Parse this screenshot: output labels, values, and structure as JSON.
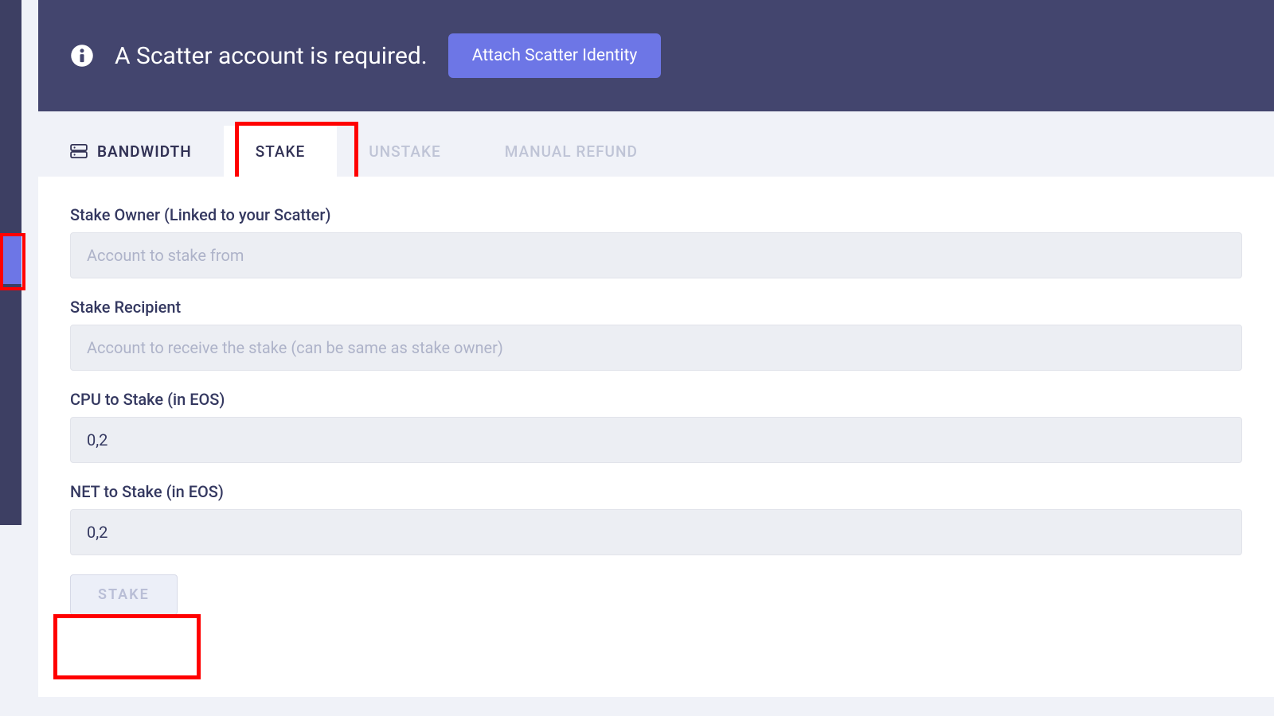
{
  "banner": {
    "message": "A Scatter account is required.",
    "attach_label": "Attach Scatter Identity"
  },
  "tabs": {
    "bandwidth": "BANDWIDTH",
    "stake": "STAKE",
    "unstake": "UNSTAKE",
    "manual_refund": "MANUAL REFUND"
  },
  "form": {
    "stake_owner": {
      "label": "Stake Owner (Linked to your Scatter)",
      "placeholder": "Account to stake from",
      "value": ""
    },
    "stake_recipient": {
      "label": "Stake Recipient",
      "placeholder": "Account to receive the stake (can be same as stake owner)",
      "value": ""
    },
    "cpu_to_stake": {
      "label": "CPU to Stake (in EOS)",
      "value": "0,2"
    },
    "net_to_stake": {
      "label": "NET to Stake (in EOS)",
      "value": "0,2"
    },
    "submit_label": "STAKE"
  },
  "colors": {
    "banner_bg": "#43456e",
    "accent": "#6d76e6",
    "sidebar_bg": "#3d3f63",
    "text_dark": "#343860",
    "highlight": "#ff0000"
  }
}
